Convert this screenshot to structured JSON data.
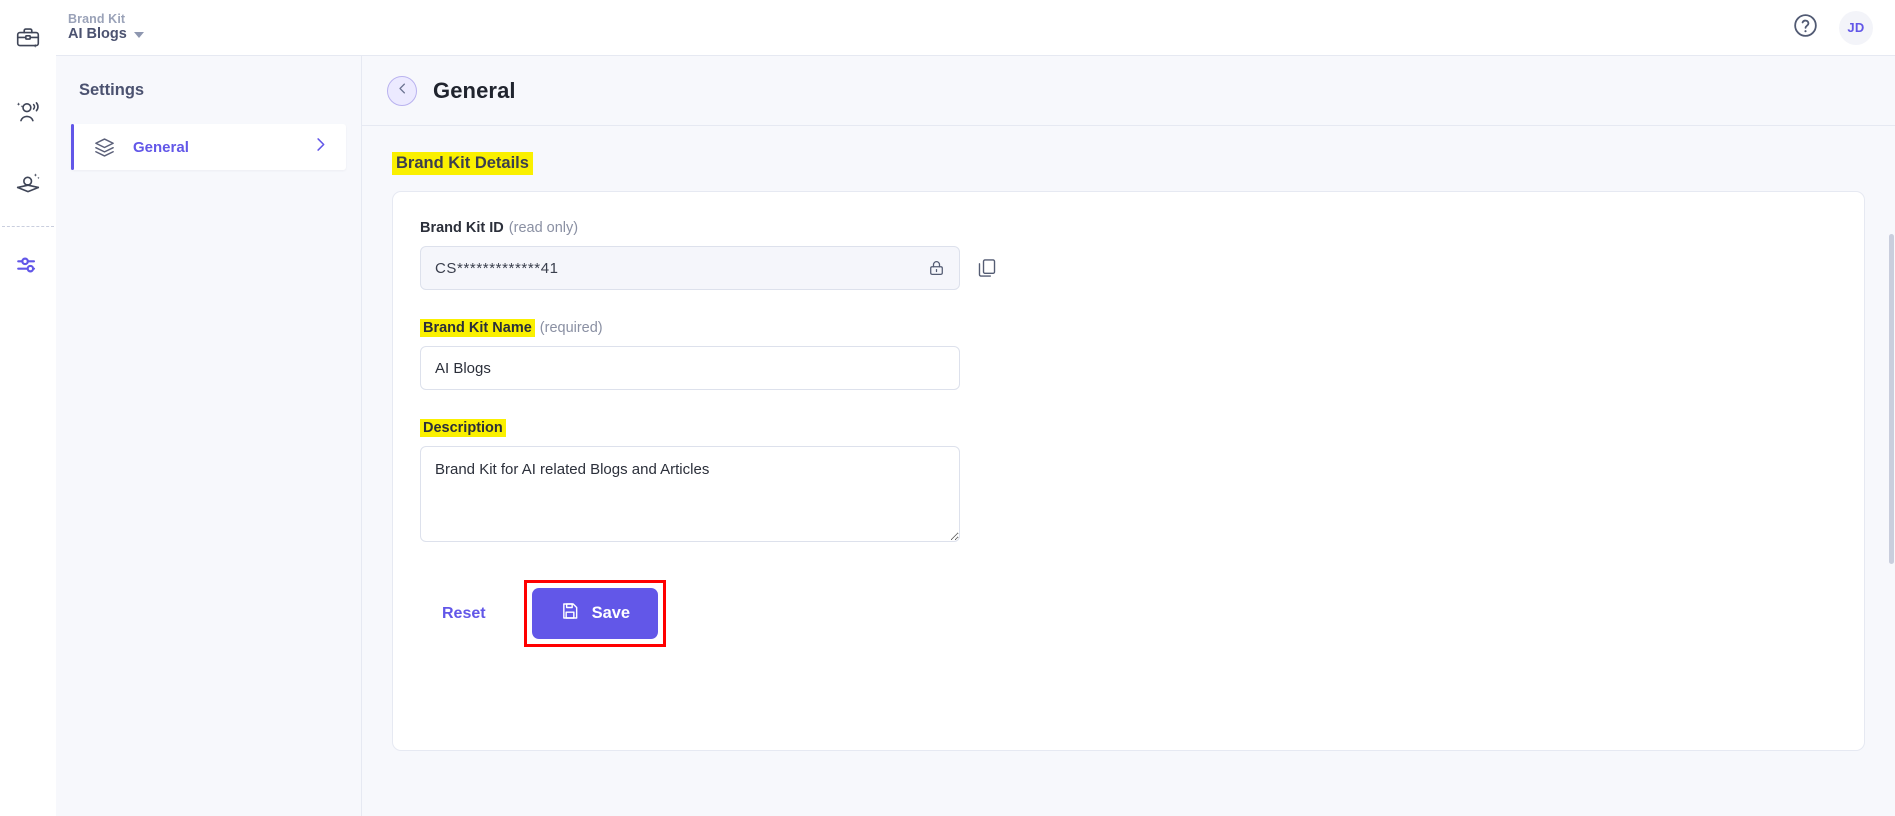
{
  "brand": {
    "accent": "#6257e8",
    "highlight": "#faf000",
    "alert_outline": "#ff0000"
  },
  "topbar": {
    "breadcrumb_label": "Brand Kit",
    "breadcrumb_value": "AI Blogs",
    "help_icon": "question-circle-icon",
    "avatar_initials": "JD"
  },
  "rail": {
    "items": [
      {
        "icon": "briefcase-sparkle-icon",
        "active": false
      },
      {
        "icon": "persona-voice-icon",
        "active": false
      },
      {
        "icon": "knowledge-book-icon",
        "active": false
      },
      {
        "icon": "settings-sliders-icon",
        "active": true
      }
    ]
  },
  "settings_sidebar": {
    "title": "Settings",
    "items": [
      {
        "label": "General",
        "icon": "layers-icon",
        "chevron": "chevron-right-icon",
        "active": true
      }
    ]
  },
  "main": {
    "back_icon": "chevron-left-icon",
    "page_title": "General",
    "section_heading": "Brand Kit Details",
    "fields": {
      "brand_kit_id": {
        "label": "Brand Kit ID",
        "hint": "(read only)",
        "value": "CS*************41",
        "lock_icon": "lock-icon",
        "copy_icon": "copy-icon"
      },
      "brand_kit_name": {
        "label": "Brand Kit Name",
        "hint": "(required)",
        "value": "AI Blogs"
      },
      "description": {
        "label": "Description",
        "hint": "",
        "value": "Brand Kit for AI related Blogs and Articles"
      }
    },
    "actions": {
      "reset_label": "Reset",
      "save_label": "Save",
      "save_icon": "floppy-disk-icon"
    }
  }
}
